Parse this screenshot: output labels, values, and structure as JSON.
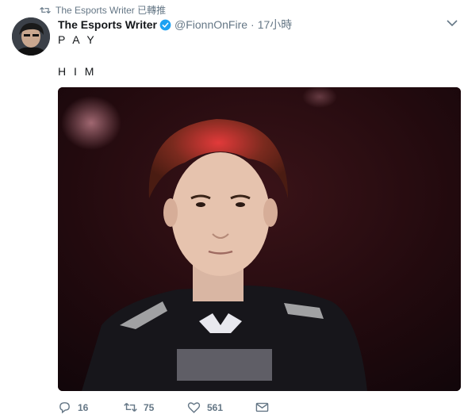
{
  "retweet": {
    "text": "The Esports Writer 已轉推",
    "icon": "retweet-icon"
  },
  "tweet": {
    "display_name": "The Esports Writer",
    "handle": "@FionnOnFire",
    "separator": "·",
    "time": "17小時",
    "line1": "P A Y",
    "line2": "H I M"
  },
  "actions": {
    "reply_count": "16",
    "retweet_count": "75",
    "like_count": "561"
  },
  "colors": {
    "accent": "#1da1f2",
    "muted": "#657786",
    "text": "#14171a"
  }
}
